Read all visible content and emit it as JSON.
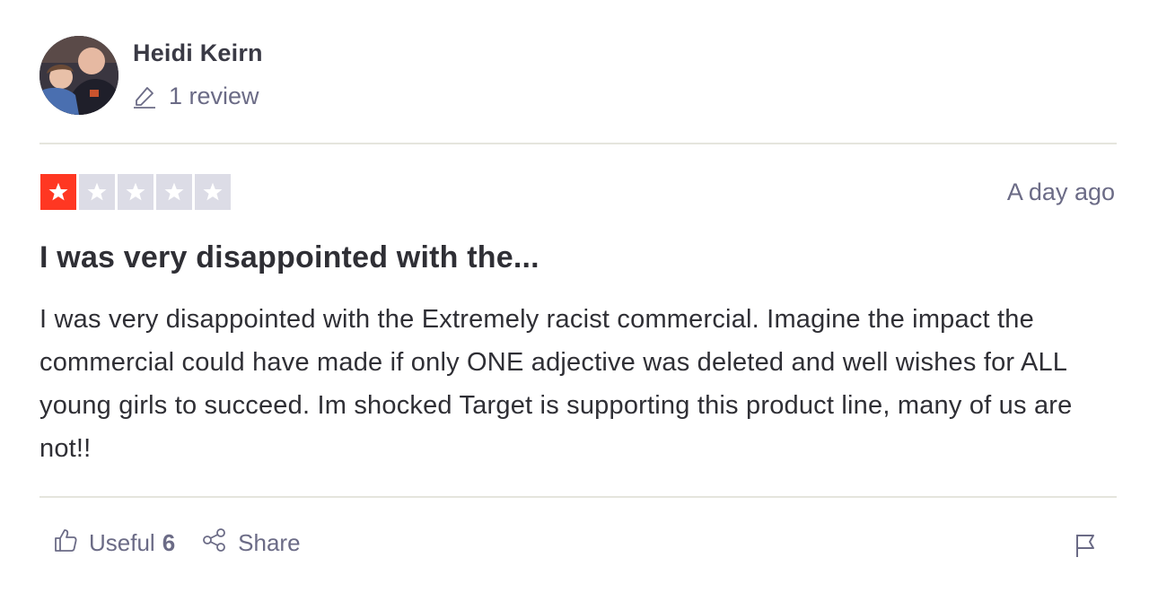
{
  "reviewer": {
    "name": "Heidi Keirn",
    "review_count": "1 review",
    "avatar_icon": "user-avatar-photo"
  },
  "review": {
    "rating": 1,
    "max_rating": 5,
    "date": "A day ago",
    "title": "I was very disappointed with the...",
    "body": "I was very disappointed with the Extremely racist commercial. Imagine the impact the commercial could have made if only ONE adjective was deleted and well wishes for ALL young girls to succeed. Im shocked Target is supporting this product line, many of us are not!!"
  },
  "actions": {
    "useful_label": "Useful",
    "useful_count": "6",
    "share_label": "Share",
    "useful_icon": "thumbs-up-icon",
    "share_icon": "share-icon",
    "flag_icon": "flag-icon"
  },
  "colors": {
    "star_filled": "#ff3722",
    "star_empty": "#dcdce6",
    "muted_text": "#6b6b86"
  }
}
